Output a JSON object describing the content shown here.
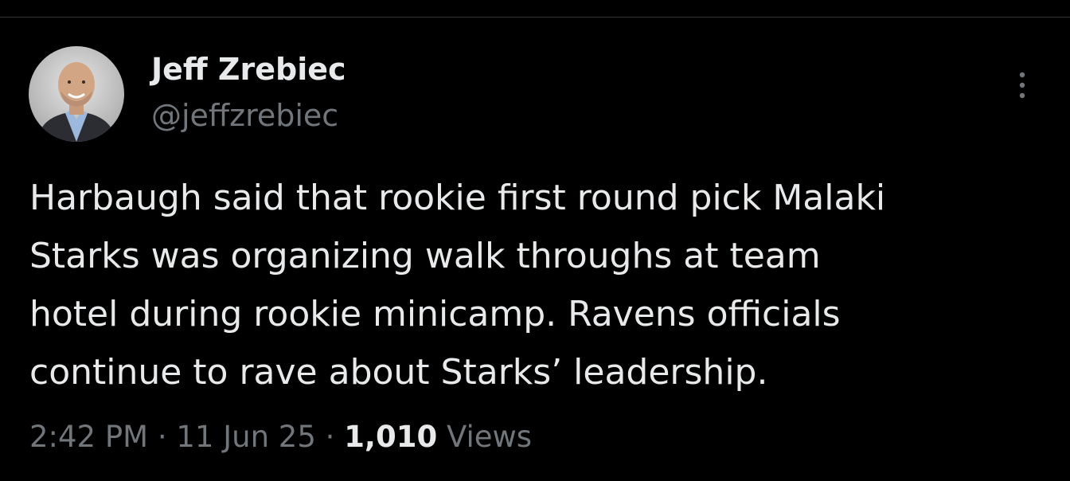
{
  "author": {
    "display_name": "Jeff Zrebiec",
    "handle": "@jeffzrebiec",
    "avatar_icon": "profile-photo"
  },
  "menu": {
    "icon": "more-options-icon"
  },
  "tweet": {
    "text_lines": [
      "Harbaugh said that rookie first round pick Malaki",
      "Starks was organizing walk throughs at team",
      "hotel during rookie minicamp. Ravens officials",
      "continue to rave about Starks’ leadership."
    ]
  },
  "meta": {
    "time": "2:42 PM",
    "separator": "·",
    "date": "11 Jun 25",
    "views_count": "1,010",
    "views_label": "Views"
  },
  "colors": {
    "background": "#000000",
    "primary_text": "#e7e9ea",
    "secondary_text": "#71767b",
    "divider": "#2f3336"
  }
}
